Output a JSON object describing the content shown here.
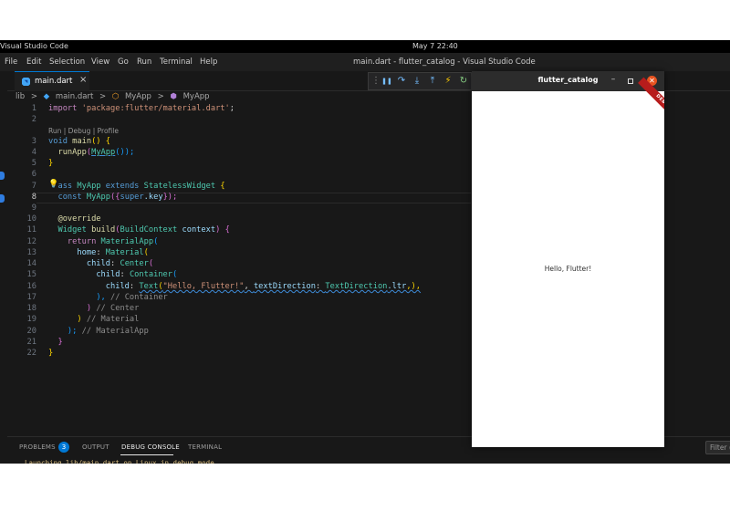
{
  "system_bar": {
    "app_name": "Visual Studio Code",
    "clock": "May 7  22:40"
  },
  "menu": [
    "File",
    "Edit",
    "Selection",
    "View",
    "Go",
    "Run",
    "Terminal",
    "Help"
  ],
  "window_title": "main.dart - flutter_catalog - Visual Studio Code",
  "editor_tab": {
    "label": "main.dart",
    "close": "×"
  },
  "debug_toolbar": {
    "icons": [
      "grip-icon",
      "pause-icon",
      "step-over-icon",
      "step-into-icon",
      "step-out-icon",
      "hot-reload-icon",
      "hot-restart-icon"
    ],
    "glyphs": [
      "⋮",
      "❚❚",
      "↷",
      "⤓",
      "⤒",
      "⚡",
      "↻"
    ]
  },
  "breadcrumb": [
    "lib",
    ">",
    "main.dart",
    ">",
    "MyApp",
    ">",
    "MyApp"
  ],
  "codelens": "Run | Debug | Profile",
  "line_numbers": [
    "1",
    "2",
    "3",
    "4",
    "5",
    "6",
    "7",
    "8",
    "9",
    "10",
    "11",
    "12",
    "13",
    "14",
    "15",
    "16",
    "17",
    "18",
    "19",
    "20",
    "21",
    "22"
  ],
  "code": {
    "l1_kw": "import",
    "l1_str": "'package:flutter/material.dart'",
    "l1_end": ";",
    "l3_kw": "void",
    "l3_fn": "main",
    "l3_end": "() {",
    "l4_fn": "runApp",
    "l4_ty": "MyApp",
    "l4_end": "());",
    "l5": "}",
    "l7_kw": "ass",
    "l7_ty1": "MyApp",
    "l7_kw2": "extends",
    "l7_ty2": "StatelessWidget",
    "l7_end": "{",
    "l8_kw": "const",
    "l8_ty": "MyApp",
    "l8_p": "({",
    "l8_kw2": "super",
    "l8_key": ".key",
    "l8_end": "});",
    "l10": "@override",
    "l11_ty": "Widget",
    "l11_fn": "build",
    "l11_ty2": "BuildContext",
    "l11_pm": "context",
    "l11_end": ") {",
    "l12_kw": "return",
    "l12_ty": "MaterialApp",
    "l12_end": "(",
    "l13_pm": "home",
    "l13_ty": "Material",
    "l13_end": "(",
    "l14_pm": "child",
    "l14_ty": "Center",
    "l14_end": "(",
    "l15_pm": "child",
    "l15_ty": "Container",
    "l15_end": "(",
    "l16_pm": "child",
    "l16_ty": "Text",
    "l16_str": "\"Hello, Flutter!\"",
    "l16_pm2": "textDirection",
    "l16_ty2": "TextDirection",
    "l16_pm3": ".ltr",
    "l16_end": ",),",
    "l17": "), ",
    "l17_cm": "// Container",
    "l18": ") ",
    "l18_cm": "// Center",
    "l19": ") ",
    "l19_cm": "// Material",
    "l20": "); ",
    "l20_cm": "// MaterialApp",
    "l21": "}",
    "l22": "}"
  },
  "panel": {
    "tabs": [
      "PROBLEMS",
      "OUTPUT",
      "DEBUG CONSOLE",
      "TERMINAL"
    ],
    "active_tab": "DEBUG CONSOLE",
    "problems_count": "3",
    "filter_placeholder": "Filter (e.g. text, !exclude)",
    "console_line": "Launching lib/main.dart on Linux in debug mode..."
  },
  "flutter_window": {
    "title": "flutter_catalog",
    "minimize": "–",
    "close": "✕",
    "body_text": "Hello, Flutter!",
    "banner": "DEBUG"
  },
  "colors": {
    "editor_bg": "#181818",
    "accent": "#0078d4",
    "close_button": "#e95420",
    "debug_banner": "#b71c1c"
  }
}
